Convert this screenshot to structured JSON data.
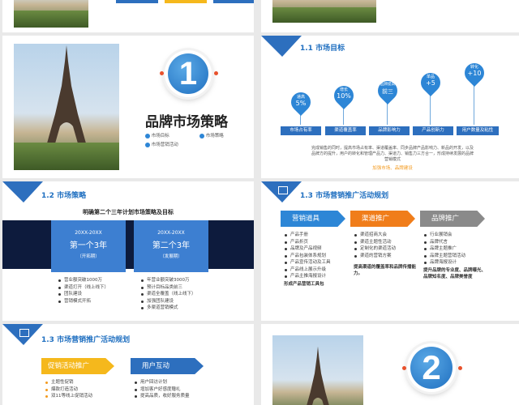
{
  "slide3": {
    "title": "品牌市场策略",
    "number": "1",
    "legend": [
      {
        "label": "市场目标"
      },
      {
        "label": "市场策略"
      },
      {
        "label": "市场营销活动"
      }
    ]
  },
  "slide4": {
    "section": "1.1 市场目标",
    "pins": [
      {
        "text": "递高\n5%",
        "top_label": "递高",
        "value": "5%",
        "bar": "市场占有率"
      },
      {
        "text": "增长\n10%",
        "top_label": "增长",
        "value": "10%",
        "bar": "渠道覆盖率"
      },
      {
        "text": "品牌提高\n前三",
        "top_label": "品牌提高",
        "value": "前三",
        "bar": "品牌影响力"
      },
      {
        "text": "单品\n+5",
        "top_label": "单品",
        "value": "+5",
        "bar": "产品创新力"
      },
      {
        "text": "转化\n+10",
        "top_label": "转化",
        "value": "+10",
        "bar": "用户数量及粘性"
      }
    ],
    "desc": "完成销售的同时，提高市场占有率、渠道覆盖率、同步品牌产品影响力、新品的开发，以及品牌方的提升，用户的转化和管理产品力、渠道力、销售力三方合一，形成持续发展的品牌营销模式",
    "highlight": "加强市场、品牌建设"
  },
  "slide5": {
    "section": "1.2 市场策略",
    "heading": "明确第二个三年计划市场策略及目标",
    "cards": [
      {
        "years": "20XX-20XX",
        "name": "第一个3年",
        "phase": "（开拓期）"
      },
      {
        "years": "20XX-20XX",
        "name": "第二个3年",
        "phase": "（发展期）"
      }
    ],
    "list1": [
      "营业额突破1000万",
      "渠道打开（线上线下）",
      "团队建设",
      "营销模式开拓"
    ],
    "list2": [
      "年营业额突破3000万",
      "预计目标品类前三",
      "渠道全覆盖（线上线下）",
      "加强团队建设",
      "多渠道营销模式"
    ]
  },
  "slide6": {
    "section": "1.3 市场营销推广活动规划",
    "columns": [
      {
        "title": "营销道具",
        "items": [
          "产品手册",
          "产品折页",
          "品牌及产品视频",
          "产品包装体系规划",
          "产品宣传活动及工具",
          "产品线上展示升级",
          "产品主推海报设计"
        ],
        "summary": "形成产品营销工具包"
      },
      {
        "title": "渠道推广",
        "items": [
          "渠道招商大会",
          "渠道主题性活动",
          "定制化的渠道活动",
          "渠道的营销方案"
        ],
        "summary": "提高渠道的覆盖率和品牌传播能力。"
      },
      {
        "title": "品牌推广",
        "items": [
          "行业展销会",
          "品牌代言",
          "品牌主题推广",
          "品牌主题营销活动",
          "品牌海报设计"
        ],
        "summary": "提升品牌的专业度、品牌曝光、品牌知名度、品牌美誉度"
      }
    ]
  },
  "slide7": {
    "section": "1.3 市场营销推广活动规划",
    "columns": [
      {
        "title": "促销活动推广",
        "items": [
          "主题性促销",
          "爆款打造活动",
          "双11等线上促销活动"
        ]
      },
      {
        "title": "用户互动",
        "items": [
          "用户回访计划",
          "增加客户好感度赠礼",
          "提高品质，收好服务质量"
        ]
      }
    ]
  },
  "slide8": {
    "number": "2"
  },
  "colors": {
    "accent": "#1f6fc0",
    "orange": "#f39a1e",
    "gray": "#8a8a8a",
    "dark": "#0d1b3d"
  }
}
